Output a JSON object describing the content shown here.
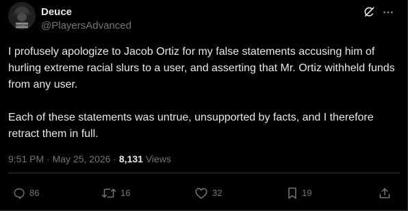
{
  "author": {
    "display_name": "Deuce",
    "handle": "@PlayersAdvanced",
    "avatar_text": "BOSTON"
  },
  "post": {
    "paragraph_1": "I profusely apologize to Jacob Ortiz for my false statements accusing him of hurling extreme racial slurs to a user, and asserting that Mr. Ortiz withheld funds from any user.",
    "paragraph_2": "Each of these statements was untrue, unsupported by facts, and I therefore retract them in full."
  },
  "meta": {
    "time": "9:51 PM",
    "separator_1": "·",
    "date": "May 25, 2026",
    "separator_2": "·",
    "views_count": "8,131",
    "views_label": "Views"
  },
  "actions": {
    "reply_count": "86",
    "repost_count": "16",
    "like_count": "32",
    "bookmark_count": "19"
  },
  "icons": {
    "grok": "grok-icon",
    "more": "more-icon",
    "reply": "reply-icon",
    "repost": "repost-icon",
    "like": "heart-icon",
    "bookmark": "bookmark-icon",
    "share": "share-icon"
  },
  "colors": {
    "background": "#000000",
    "text_primary": "#e7e9ea",
    "text_secondary": "#71767b",
    "border": "#2f3336"
  }
}
